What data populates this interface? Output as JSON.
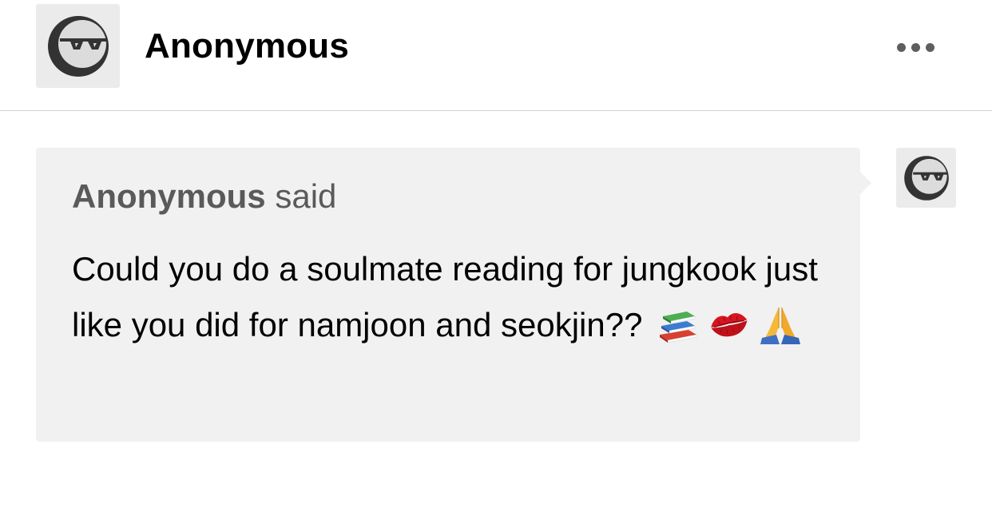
{
  "post_header": {
    "author_name": "Anonymous",
    "avatar_icon": "anonymous-sunglasses-icon",
    "more_icon": "more-options-icon"
  },
  "ask": {
    "asker_name": "Anonymous",
    "said_label": "said",
    "question_text": "Could you do a soulmate reading for jungkook just like you did for namjoon and seokjin??",
    "emojis": [
      "books-emoji",
      "kiss-mark-emoji",
      "folded-hands-emoji"
    ],
    "bubble_color": "#f1f1f1",
    "asker_avatar_icon": "anonymous-sunglasses-icon"
  }
}
